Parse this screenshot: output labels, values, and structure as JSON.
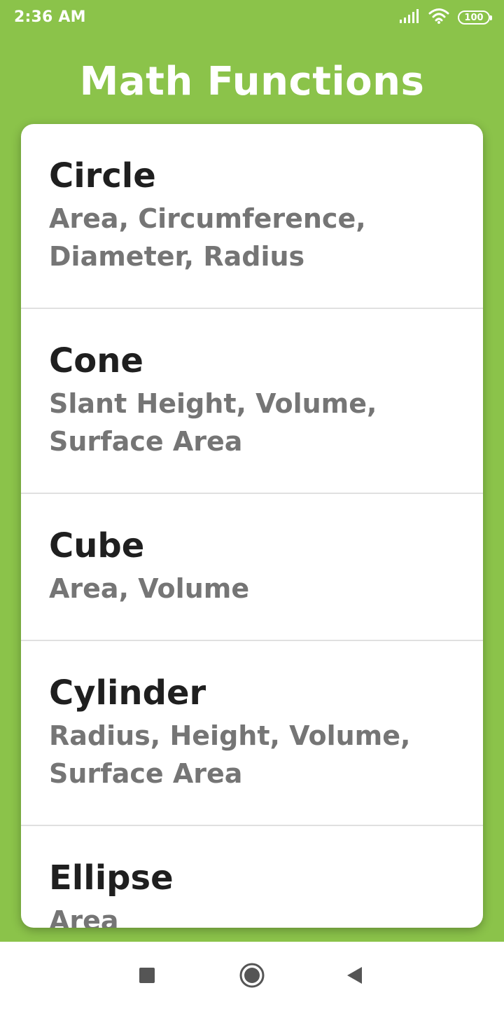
{
  "status_bar": {
    "time": "2:36 AM",
    "battery": "100",
    "icons": [
      "signal-icon",
      "wifi-icon",
      "battery-icon"
    ]
  },
  "app": {
    "title": "Math Functions"
  },
  "list": {
    "items": [
      {
        "title": "Circle",
        "subtitle": "Area, Circumference, Diameter, Radius"
      },
      {
        "title": "Cone",
        "subtitle": "Slant Height, Volume, Surface Area"
      },
      {
        "title": "Cube",
        "subtitle": "Area, Volume"
      },
      {
        "title": "Cylinder",
        "subtitle": "Radius, Height, Volume, Surface Area"
      },
      {
        "title": "Ellipse",
        "subtitle": "Area"
      }
    ]
  },
  "nav_bar": {
    "buttons": [
      "recents-icon",
      "home-icon",
      "back-icon"
    ]
  },
  "colors": {
    "accent": "#8bc34a",
    "card": "#ffffff",
    "title_text": "#1f1f1f",
    "subtitle_text": "#757575"
  }
}
